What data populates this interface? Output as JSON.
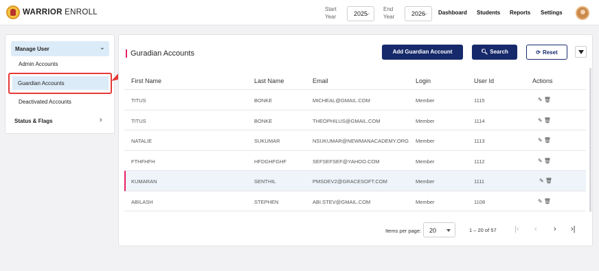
{
  "header": {
    "brand_bold": "WARRIOR",
    "brand_rest": " ENROLL",
    "start_year_label_1": "Start",
    "start_year_label_2": "Year",
    "start_year_value": "2025",
    "end_year_label_1": "End",
    "end_year_label_2": "Year",
    "end_year_value": "2026",
    "nav": [
      "Dashboard",
      "Students",
      "Reports",
      "Settings"
    ]
  },
  "sidebar": {
    "group_label": "Manage User",
    "items": [
      "Admin Accounts",
      "Guardian Accounts",
      "Deactivated Accounts"
    ],
    "active_item": "Guardian Accounts",
    "status_label": "Status & Flags"
  },
  "main": {
    "title": "Guradian Accounts",
    "add_button": "Add Guardian Account",
    "search_button": "Search",
    "reset_button": "Reset",
    "columns": [
      "First Name",
      "Last Name",
      "Email",
      "Login",
      "User Id",
      "Actions"
    ],
    "rows": [
      [
        "TITUS",
        "BONKE",
        "MICHEAL@GMAIL.COM",
        "Member",
        "1115"
      ],
      [
        "TITUS",
        "BONKE",
        "THEOPHILUS@GMAIL.COM",
        "Member",
        "1114"
      ],
      [
        "NATALIE",
        "SUKUMAR",
        "NSUKUMAR@NEWMANACADEMY.ORG",
        "Member",
        "1113"
      ],
      [
        "FTHFHFH",
        "HFDGHFGHF",
        "SEFSEFSEF@YAHOO.COM",
        "Member",
        "1112"
      ],
      [
        "KUMARAN",
        "SENTHIL",
        "PMSDEV2@GRACESOFT.COM",
        "Member",
        "1111"
      ],
      [
        "ABILASH",
        "STEPHEN",
        "ABI.STEV@GMAIL.COM",
        "Member",
        "1108"
      ]
    ],
    "selected_row": 4
  },
  "paginator": {
    "items_per_page_label": "Items per page:",
    "items_per_page": "20",
    "range": "1 – 20 of 57"
  },
  "colors": {
    "primary": "#16296b",
    "accent": "#e91e63",
    "highlight": "#e53935",
    "active_bg": "#dcebf8"
  }
}
